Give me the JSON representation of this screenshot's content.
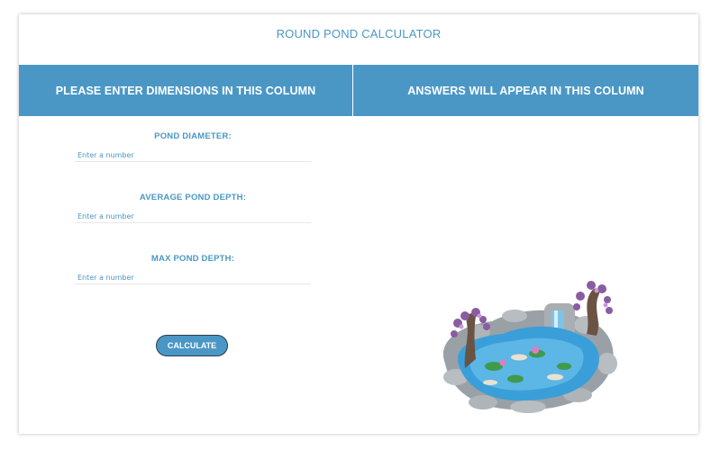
{
  "title": "ROUND POND CALCULATOR",
  "header": {
    "left": "PLEASE ENTER DIMENSIONS IN THIS COLUMN",
    "right": "ANSWERS WILL APPEAR IN THIS COLUMN"
  },
  "fields": [
    {
      "label": "POND DIAMETER:",
      "placeholder": "Enter a number",
      "value": ""
    },
    {
      "label": "AVERAGE POND DEPTH:",
      "placeholder": "Enter a number",
      "value": ""
    },
    {
      "label": "MAX POND DEPTH:",
      "placeholder": "Enter a number",
      "value": ""
    }
  ],
  "calculate_label": "CALCULATE",
  "colors": {
    "accent": "#4a97c6",
    "header_text": "#ffffff",
    "button_border": "#2a3c4a"
  }
}
